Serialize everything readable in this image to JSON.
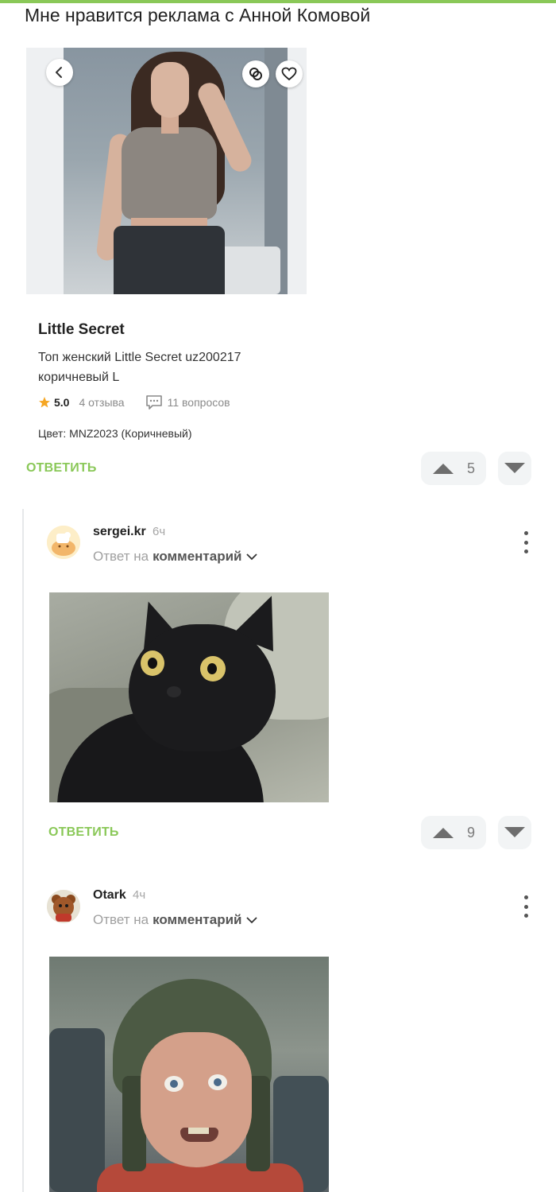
{
  "post": {
    "text": "Мне нравится реклама с Анной Комовой"
  },
  "product_card": {
    "brand": "Little Secret",
    "name": "Топ женский Little Secret uz200217 коричневый L",
    "rating": "5.0",
    "reviews": "4 отзыва",
    "questions": "11 вопросов",
    "color_line": "Цвет: MNZ2023 (Коричневый)"
  },
  "post_actions": {
    "reply_label": "ОТВЕТИТЬ",
    "upvotes": "5"
  },
  "comments": [
    {
      "username": "sergei.kr",
      "time": "6ч",
      "reply_prefix": "Ответ на",
      "reply_link": "комментарий",
      "reply_label": "ОТВЕТИТЬ",
      "upvotes": "9"
    },
    {
      "username": "Otark",
      "time": "4ч",
      "reply_prefix": "Ответ на",
      "reply_link": "комментарий"
    }
  ],
  "colors": {
    "accent": "#8ac858",
    "vote_bg": "#f2f4f5",
    "rating_star": "#f5a623"
  },
  "icons": [
    "back-icon",
    "share-icon",
    "heart-icon",
    "star-icon",
    "chat-icon",
    "arrow-up-icon",
    "arrow-down-icon",
    "chevron-down-icon",
    "more-vertical-icon"
  ]
}
